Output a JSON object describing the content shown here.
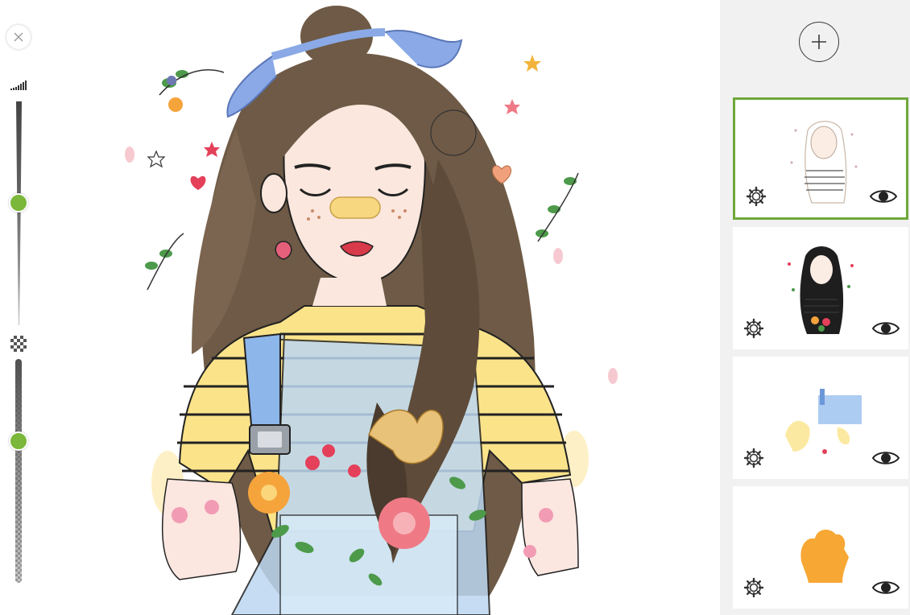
{
  "toolbar": {
    "close_icon": "close-icon",
    "brush_size_icon": "signal-bars-icon",
    "opacity_icon": "checkerboard-icon",
    "brush_size_level": 0.45,
    "opacity_level": 0.37,
    "accent_color": "#7bb73a"
  },
  "layers": {
    "add_icon": "plus-icon",
    "active_border_color": "#6fa83a",
    "items": [
      {
        "name": "layer-1",
        "active": true,
        "visible": true,
        "thumbnail": "sketch-lineart"
      },
      {
        "name": "layer-2",
        "active": false,
        "visible": true,
        "thumbnail": "girl-portrait"
      },
      {
        "name": "layer-3",
        "active": false,
        "visible": true,
        "thumbnail": "color-blocks"
      },
      {
        "name": "layer-4",
        "active": false,
        "visible": true,
        "thumbnail": "orange-silhouette"
      }
    ]
  }
}
